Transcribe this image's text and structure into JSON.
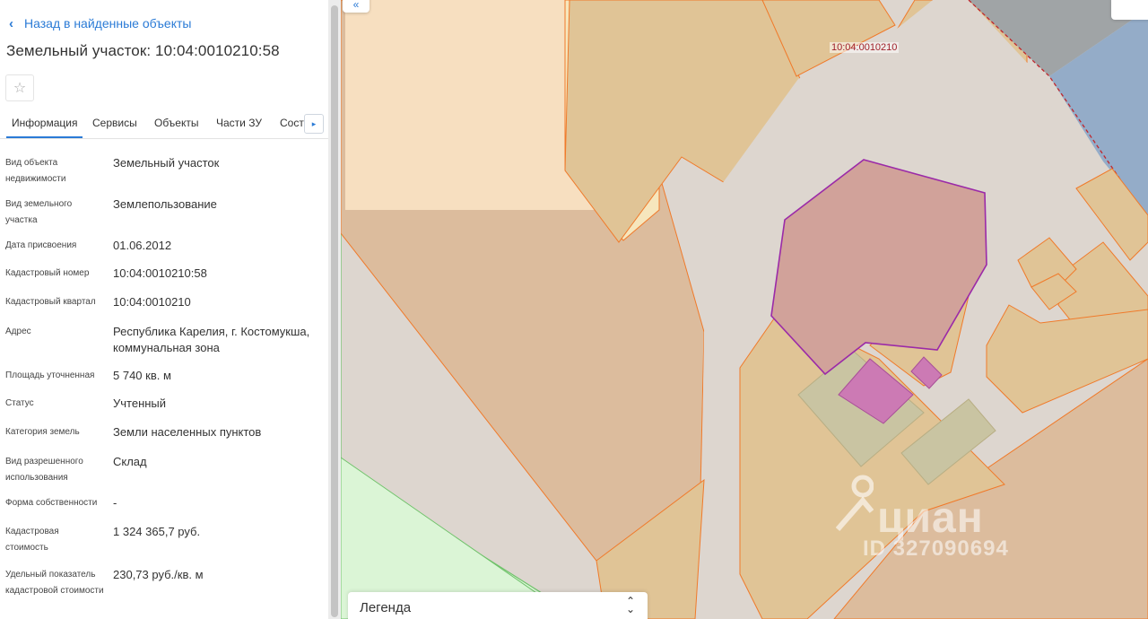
{
  "panel": {
    "back_label": "Назад в найденные объекты",
    "title": "Земельный участок: 10:04:0010210:58",
    "tabs": [
      {
        "label": "Информация",
        "active": true
      },
      {
        "label": "Сервисы",
        "active": false
      },
      {
        "label": "Объекты",
        "active": false
      },
      {
        "label": "Части ЗУ",
        "active": false
      },
      {
        "label": "Состав",
        "active": false
      }
    ],
    "info": [
      {
        "label": "Вид объекта недвижимости",
        "value": "Земельный участок"
      },
      {
        "label": "Вид земельного участка",
        "value": "Землепользование"
      },
      {
        "label": "Дата присвоения",
        "value": "01.06.2012"
      },
      {
        "label": "Кадастровый номер",
        "value": "10:04:0010210:58"
      },
      {
        "label": "Кадастровый квартал",
        "value": "10:04:0010210"
      },
      {
        "label": "Адрес",
        "value": "Республика Карелия, г. Костомукша, коммунальная зона"
      },
      {
        "label": "Площадь уточненная",
        "value": "5 740 кв. м"
      },
      {
        "label": "Статус",
        "value": "Учтенный"
      },
      {
        "label": "Категория земель",
        "value": "Земли населенных пунктов"
      },
      {
        "label": "Вид разрешенного использования",
        "value": "Склад"
      },
      {
        "label": "Форма собственности",
        "value": "-"
      },
      {
        "label": "Кадастровая стоимость",
        "value": "1 324 365,7 руб."
      },
      {
        "label": "Удельный показатель кадастровой стоимости",
        "value": "230,73 руб./кв. м"
      }
    ]
  },
  "map": {
    "quarter_label": "10:04:0010210",
    "legend_label": "Легенда",
    "collapse_icon": "double-chevron-left-icon",
    "watermark_brand": "циан",
    "watermark_id": "ID 327090694"
  },
  "colors": {
    "accent": "#2b7bd6",
    "parcel_fill": "#e0c496",
    "parcel_border": "#f07a2a",
    "selected_fill": "#d1a29a",
    "selected_border": "#9b2aa8",
    "building_fill": "#cc7ab4",
    "green_zone": "#dbf5d6",
    "blue_zone": "#94acc8"
  }
}
